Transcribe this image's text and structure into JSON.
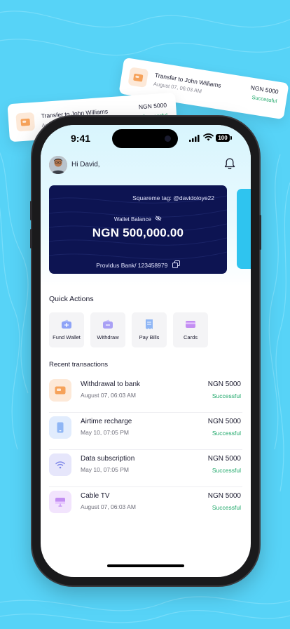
{
  "floating_cards": [
    {
      "title": "Transfer to John Williams",
      "date": "August 07, 06:03 AM",
      "amount": "NGN 5000",
      "status": "Successful"
    },
    {
      "title": "Transfer to John Williams",
      "date": "August 07, 06:03 AM",
      "amount": "NGN 5000",
      "status": "Successful"
    }
  ],
  "status_bar": {
    "time": "9:41",
    "battery": "100"
  },
  "header": {
    "greeting": "Hi David,"
  },
  "wallet": {
    "tag": "Squareme tag: @davidoloye22",
    "label": "Wallet Balance",
    "balance": "NGN 500,000.00",
    "bank": "Providus Bank/ 123458979"
  },
  "quick_actions": {
    "title": "Quick Actions",
    "items": [
      {
        "label": "Fund Wallet",
        "icon": "wallet-plus-icon"
      },
      {
        "label": "Withdraw",
        "icon": "wallet-minus-icon"
      },
      {
        "label": "Pay Bills",
        "icon": "receipt-icon"
      },
      {
        "label": "Cards",
        "icon": "card-icon"
      }
    ]
  },
  "recent": {
    "title": "Recent transactions",
    "items": [
      {
        "title": "Withdrawal to bank",
        "date": "August 07, 06:03 AM",
        "amount": "NGN 5000",
        "status": "Successful",
        "icon": "bank-card-icon"
      },
      {
        "title": "Airtime recharge",
        "date": "May 10, 07:05 PM",
        "amount": "NGN 5000",
        "status": "Successful",
        "icon": "phone-icon"
      },
      {
        "title": "Data subscription",
        "date": "May 10, 07:05 PM",
        "amount": "NGN 5000",
        "status": "Successful",
        "icon": "wifi-icon"
      },
      {
        "title": "Cable TV",
        "date": "August 07, 06:03 AM",
        "amount": "NGN 5000",
        "status": "Successful",
        "icon": "tv-icon"
      }
    ]
  },
  "colors": {
    "background": "#57d3f7",
    "wallet_card": "#0d1452",
    "success": "#1fa86a",
    "accent": "#2fc4ef"
  }
}
